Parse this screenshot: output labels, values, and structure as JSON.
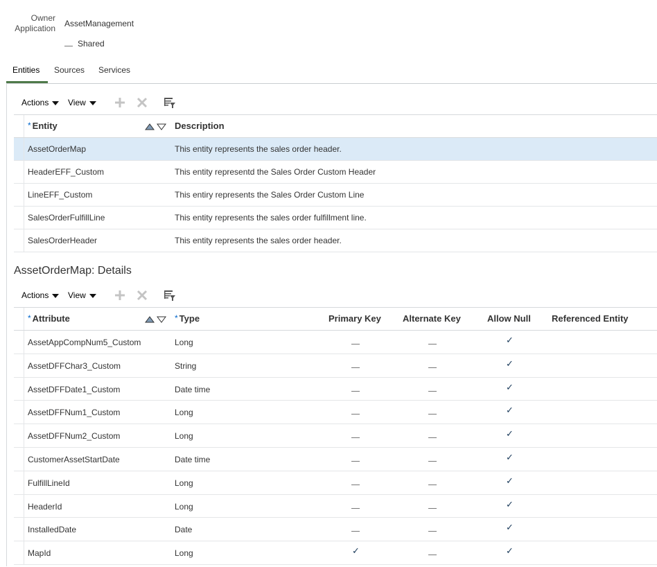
{
  "owner": {
    "label_line1": "Owner",
    "label_line2": "Application",
    "value": "AssetManagement",
    "shared_label": "Shared"
  },
  "tabs": [
    {
      "label": "Entities",
      "active": true
    },
    {
      "label": "Sources",
      "active": false
    },
    {
      "label": "Services",
      "active": false
    }
  ],
  "entities_toolbar": {
    "actions": "Actions",
    "view": "View",
    "add_icon": "plus-icon",
    "delete_icon": "x-icon",
    "detach_icon": "detach-icon"
  },
  "entities_table": {
    "headers": {
      "entity": "Entity",
      "description": "Description",
      "required_marker": "*"
    },
    "rows": [
      {
        "entity": "AssetOrderMap",
        "description": "This entity represents the sales order header.",
        "selected": true
      },
      {
        "entity": "HeaderEFF_Custom",
        "description": "This entity representd the Sales Order Custom Header",
        "selected": false
      },
      {
        "entity": "LineEFF_Custom",
        "description": "This entiry represents the Sales Order Custom Line",
        "selected": false
      },
      {
        "entity": "SalesOrderFulfillLine",
        "description": "This entity represents the sales order fulfillment line.",
        "selected": false
      },
      {
        "entity": "SalesOrderHeader",
        "description": "This entity represents the sales order header.",
        "selected": false
      }
    ]
  },
  "details": {
    "title": "AssetOrderMap: Details",
    "toolbar": {
      "actions": "Actions",
      "view": "View"
    },
    "headers": {
      "attribute": "Attribute",
      "type": "Type",
      "primary_key": "Primary Key",
      "alternate_key": "Alternate Key",
      "allow_null": "Allow Null",
      "referenced_entity": "Referenced Entity",
      "required_marker": "*"
    },
    "rows": [
      {
        "attribute": "AssetAppCompNum5_Custom",
        "type": "Long",
        "pk": false,
        "ak": false,
        "null": true,
        "ref": ""
      },
      {
        "attribute": "AssetDFFChar3_Custom",
        "type": "String",
        "pk": false,
        "ak": false,
        "null": true,
        "ref": ""
      },
      {
        "attribute": "AssetDFFDate1_Custom",
        "type": "Date time",
        "pk": false,
        "ak": false,
        "null": true,
        "ref": ""
      },
      {
        "attribute": "AssetDFFNum1_Custom",
        "type": "Long",
        "pk": false,
        "ak": false,
        "null": true,
        "ref": ""
      },
      {
        "attribute": "AssetDFFNum2_Custom",
        "type": "Long",
        "pk": false,
        "ak": false,
        "null": true,
        "ref": ""
      },
      {
        "attribute": "CustomerAssetStartDate",
        "type": "Date time",
        "pk": false,
        "ak": false,
        "null": true,
        "ref": ""
      },
      {
        "attribute": "FulfillLineId",
        "type": "Long",
        "pk": false,
        "ak": false,
        "null": true,
        "ref": ""
      },
      {
        "attribute": "HeaderId",
        "type": "Long",
        "pk": false,
        "ak": false,
        "null": true,
        "ref": ""
      },
      {
        "attribute": "InstalledDate",
        "type": "Date",
        "pk": false,
        "ak": false,
        "null": true,
        "ref": ""
      },
      {
        "attribute": "MapId",
        "type": "Long",
        "pk": true,
        "ak": false,
        "null": true,
        "ref": ""
      }
    ]
  },
  "colors": {
    "selected_row": "#dbeaf7",
    "tab_underline": "#4f7a4a",
    "required": "#0066cc"
  }
}
